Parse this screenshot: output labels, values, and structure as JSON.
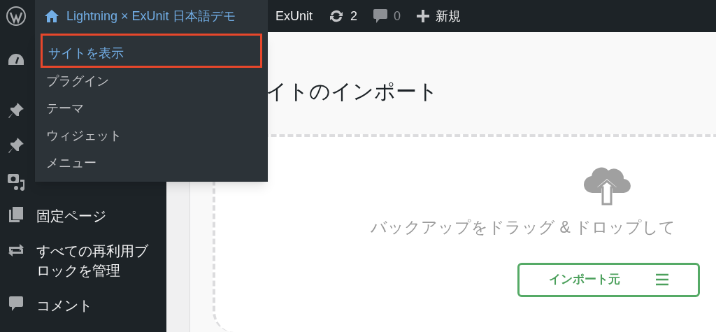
{
  "admin_bar": {
    "site_name": "Lightning × ExUnit 日本語デモ",
    "items": [
      {
        "kind": "text",
        "label": "ExUnit"
      },
      {
        "kind": "updates",
        "label": "2"
      },
      {
        "kind": "comments",
        "label": "0",
        "disabled": true
      },
      {
        "kind": "new",
        "label": "新規"
      }
    ]
  },
  "site_menu": [
    {
      "label": "サイトを表示",
      "highlighted": true
    },
    {
      "label": "プラグイン",
      "highlighted": false
    },
    {
      "label": "テーマ",
      "highlighted": false
    },
    {
      "label": "ウィジェット",
      "highlighted": false
    },
    {
      "label": "メニュー",
      "highlighted": false
    }
  ],
  "sidebar": {
    "items": [
      {
        "kind": "dashboard"
      },
      {
        "kind": "pin"
      },
      {
        "kind": "pin"
      },
      {
        "kind": "media"
      },
      {
        "kind": "pages",
        "label": "固定ページ"
      },
      {
        "kind": "reusable",
        "label": "すべての再利用ブロックを管理"
      },
      {
        "kind": "comments",
        "label": "コメント"
      }
    ]
  },
  "page": {
    "title": "イトのインポート",
    "dropzone_text": "バックアップをドラッグ & ドロップして",
    "import_button": "インポート元"
  }
}
